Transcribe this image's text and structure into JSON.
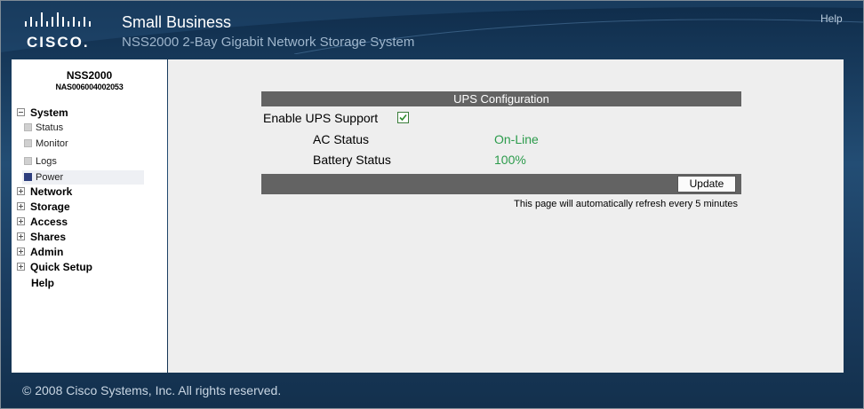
{
  "header": {
    "logo_text": "CISCO.",
    "brand": "Small Business",
    "product": "NSS2000 2-Bay Gigabit Network Storage System",
    "help_link": "Help"
  },
  "sidebar": {
    "device_name": "NSS2000",
    "device_serial": "NAS006004002053",
    "items": [
      {
        "label": "System",
        "expanded": true
      },
      {
        "label": "Status"
      },
      {
        "label": "Monitor"
      },
      {
        "label": "Logs"
      },
      {
        "label": "Power",
        "selected": true
      },
      {
        "label": "Network"
      },
      {
        "label": "Storage"
      },
      {
        "label": "Access"
      },
      {
        "label": "Shares"
      },
      {
        "label": "Admin"
      },
      {
        "label": "Quick Setup"
      },
      {
        "label": "Help"
      }
    ]
  },
  "ups": {
    "title": "UPS Configuration",
    "enable_label": "Enable UPS Support",
    "enable_checked": true,
    "ac_status_label": "AC Status",
    "ac_status_value": "On-Line",
    "battery_status_label": "Battery Status",
    "battery_status_value": "100%",
    "update_button": "Update",
    "refresh_note": "This page will automatically refresh every 5 minutes"
  },
  "footer": {
    "copyright": "© 2008 Cisco Systems, Inc. All rights reserved."
  },
  "colors": {
    "header_bg": "#1b3d60",
    "status_value": "#2b9b4b",
    "bar_gray": "#636363",
    "selected_marker": "#2d3e7d"
  }
}
